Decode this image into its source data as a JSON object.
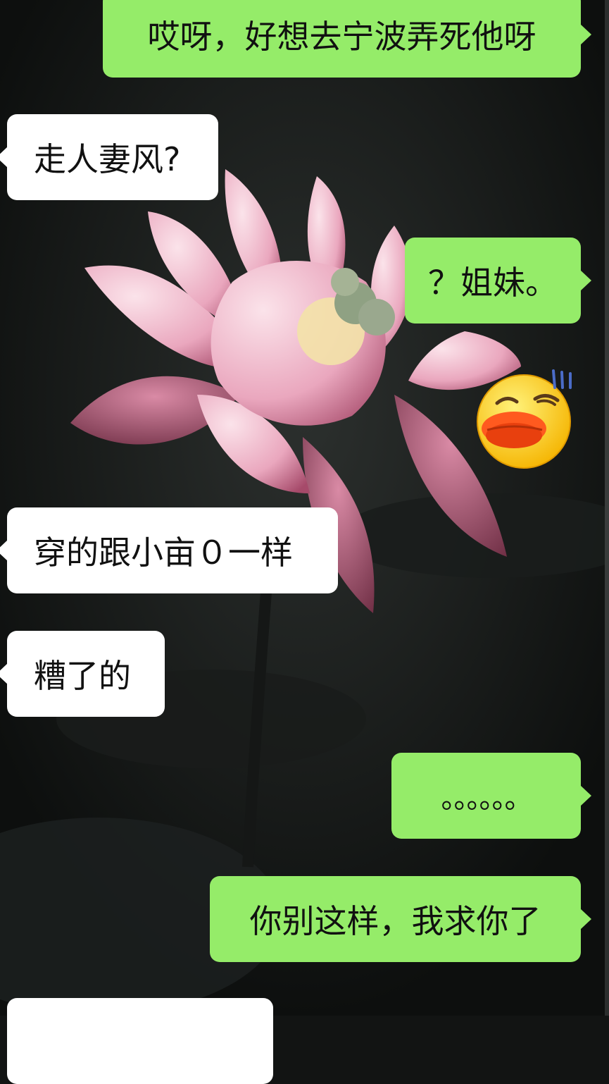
{
  "messages": [
    {
      "side": "out",
      "text": "哎呀，好想去宁波弄死他呀"
    },
    {
      "side": "in",
      "text": "走人妻风?"
    },
    {
      "side": "out",
      "text": "？姐妹。"
    },
    {
      "side": "out",
      "type": "sticker",
      "icon": "duck-mouth-smug-emoji"
    },
    {
      "side": "in",
      "text": "穿的跟小亩０一样"
    },
    {
      "side": "in",
      "text": "糟了的"
    },
    {
      "side": "out",
      "text": "。。。。。。"
    },
    {
      "side": "out",
      "text": "你别这样，我求你了"
    },
    {
      "side": "in",
      "text": ""
    }
  ],
  "colors": {
    "outgoing_bubble": "#95ec69",
    "incoming_bubble": "#ffffff",
    "background": "#121413",
    "lotus": "#f2b8cc"
  }
}
